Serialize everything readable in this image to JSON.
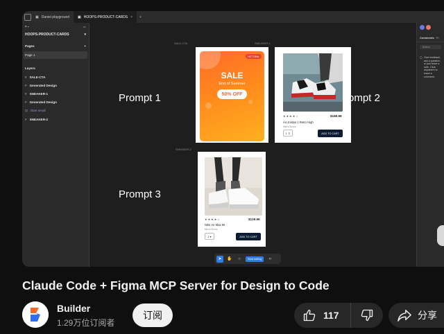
{
  "browser": {
    "tabs": [
      {
        "label": "Daniel playground"
      },
      {
        "label": "HOOPS-PRODUCT-CARDS"
      }
    ],
    "close_glyph": "×",
    "new_tab_glyph": "+"
  },
  "sidebar": {
    "file_name": "HOOPS-PRODUCT-CARDS",
    "pages_heading": "Pages",
    "page_item": "Page 1",
    "layers_heading": "Layers",
    "layers": [
      {
        "label": "SALE-CTA"
      },
      {
        "label": "Generated Design"
      },
      {
        "label": "SNEAKER-1"
      },
      {
        "label": "Generated Design"
      },
      {
        "label": "Start small"
      },
      {
        "label": "SNEAKER-2"
      }
    ]
  },
  "canvas": {
    "prompts": [
      "Prompt 1",
      "Prompt 2",
      "Prompt 3"
    ],
    "sale_card": {
      "frame_label": "SALE-CTA",
      "badge": "HOT DEAL",
      "title": "SALE",
      "subtitle": "End of Summer",
      "pill": "50% OFF"
    },
    "sneaker1": {
      "frame_label": "SNEAKER-1",
      "stars": "★★★★☆",
      "price": "$189.99",
      "name": "Air Jordan 1 Retro High",
      "category": "Men's Shoes",
      "qty": "1 ⇕",
      "button": "ADD TO CART"
    },
    "sneaker2": {
      "frame_label": "SNEAKER-2",
      "stars": "★★★★☆",
      "price": "$129.99",
      "name": "Nike Air Max 90",
      "category": "Men's Shoes",
      "qty": "1 ▾",
      "button": "ADD TO CART"
    }
  },
  "right_panel": {
    "tabs": [
      "Comments",
      "Pr"
    ],
    "search_placeholder": "Search",
    "comment_text": "Give feedback, ask a question, or just leave a note. Click anywhere to leave a comment."
  },
  "toolbar": {
    "start_editing": "Start editing",
    "icons": [
      "cursor-icon",
      "hand-icon",
      "comment-icon",
      "code-icon"
    ]
  },
  "video": {
    "title": "Claude Code + Figma MCP Server for Design to Code",
    "channel_name": "Builder",
    "subscribers": "1.29万位订阅者",
    "subscribe_label": "订阅",
    "like_count": "117",
    "share_label": "分享"
  },
  "colors": {
    "accent_blue": "#2f7ee8",
    "sale_orange": "#ff6a2a",
    "cart_navy": "#0b1c33",
    "brand_orange": "#f26b2a",
    "brand_blue": "#2f6fed"
  }
}
